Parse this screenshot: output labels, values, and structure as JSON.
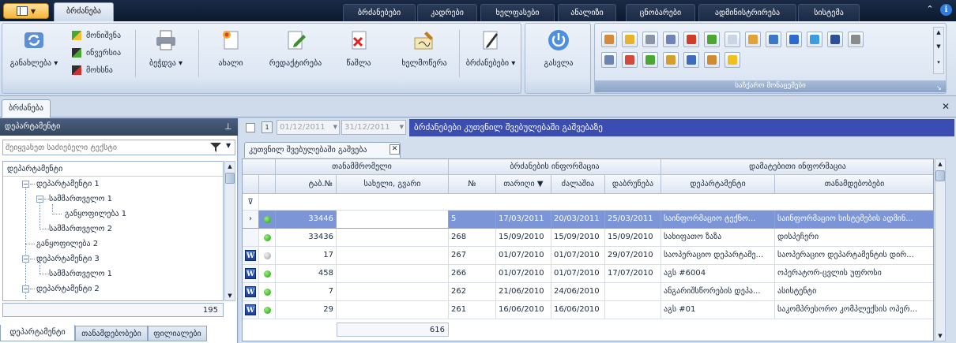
{
  "top_tabs": {
    "active": "ბრძანება",
    "items": [
      "ბრძანებები",
      "კადრები",
      "ხელფასები",
      "ანალიზი",
      "ცნობარები",
      "ადმინისტრირება",
      "სისტემა"
    ]
  },
  "ribbon": {
    "refresh_label": "განახლება",
    "mark_label": "მონიშვნა",
    "invert_label": "ინვერსია",
    "remove_label": "მოხსნა",
    "print_label": "ბეჭდვა",
    "new_label": "ახალი",
    "edit_label": "რედაქტირება",
    "delete_label": "წაშლა",
    "sign_label": "ხელმოწერა",
    "orders_label": "ბრძანებები",
    "exit_label": "გასვლა",
    "quick_group_label": "საჩქარო მონაცემები"
  },
  "doc_tab": "ბრძანება",
  "left": {
    "title": "დეპარტამენტი",
    "search_placeholder": "შეიყვანეთ საძიებელი ტექსტი",
    "tree": [
      {
        "label": "დეპარტამენტი",
        "level": 0
      },
      {
        "label": "დეპარტამენტი 1",
        "level": 1
      },
      {
        "label": "სამმართველო 1",
        "level": 2
      },
      {
        "label": "განყოფილება 1",
        "level": 3
      },
      {
        "label": "სამმართველო 2",
        "level": 2
      },
      {
        "label": "განყოფილება 2",
        "level": 1
      },
      {
        "label": "დეპარტამენტი 3",
        "level": 1
      },
      {
        "label": "სამმართველო 1",
        "level": 2
      },
      {
        "label": "დეპარტამენტი 2",
        "level": 1
      }
    ],
    "count": "195",
    "bottom_tabs": [
      "დეპარტამენტი",
      "თანამდებობები",
      "ფილიალები"
    ]
  },
  "right": {
    "date_from": "01/12/2011",
    "date_to": "31/12/2011",
    "banner": "ბრძანებები კუთვნილ შვებულებაში გაშვებაზე",
    "subtab": "კუთვნილ შვებულებაში გაშვება",
    "group_headers": [
      "თანამშრომელი",
      "ბრძანების ინფორმაცია",
      "დამატებითი ინფორმაცია"
    ],
    "columns": [
      "ტაბ.№",
      "სახელი, გვარი",
      "№",
      "თარიღი",
      "ძალაშია",
      "დაბრუნება",
      "დეპარტამენტი",
      "თანამდებობები"
    ],
    "rows": [
      {
        "tab": "33446",
        "num": "5",
        "date": "17/03/2011",
        "valid": "20/03/2011",
        "ret": "25/03/2011",
        "dept": "საინფორმაციო ტექნო...",
        "pos": "საინფორმაციო სისტემების ადმინ...",
        "status": "green",
        "word": false,
        "selected": true
      },
      {
        "tab": "33436",
        "num": "268",
        "date": "15/09/2010",
        "valid": "15/09/2010",
        "ret": "15/09/2010",
        "dept": "სახიფათო ზაზა",
        "pos": "დისპეჩერი",
        "status": "green",
        "word": false,
        "selected": false
      },
      {
        "tab": "17",
        "num": "267",
        "date": "01/07/2010",
        "valid": "01/07/2010",
        "ret": "29/07/2010",
        "dept": "საოპერაციო დეპარტამე...",
        "pos": "საოპერაციო დეპარტამენტის დირ...",
        "status": "gray",
        "word": true,
        "selected": false
      },
      {
        "tab": "458",
        "num": "266",
        "date": "01/07/2010",
        "valid": "01/07/2010",
        "ret": "17/07/2010",
        "dept": "აგს #6004",
        "pos": "ოპერატორ-ცვლის უფროსი",
        "status": "green",
        "word": true,
        "selected": false
      },
      {
        "tab": "7",
        "num": "262",
        "date": "21/06/2010",
        "valid": "24/06/2010",
        "ret": "",
        "dept": "ანგარიშსწორების დეპა...",
        "pos": "ასისტენტი",
        "status": "green",
        "word": true,
        "selected": false
      },
      {
        "tab": "29",
        "num": "261",
        "date": "16/06/2010",
        "valid": "16/06/2010",
        "ret": "",
        "dept": "აგს #01",
        "pos": "საკომპრესორო კომპლექსის ოპერ...",
        "status": "green",
        "word": true,
        "selected": false
      }
    ],
    "footer_count": "616"
  },
  "colors": {
    "accent": "#3c4db1",
    "selected_row": "#7b95d6",
    "topbar": "#14233c"
  }
}
